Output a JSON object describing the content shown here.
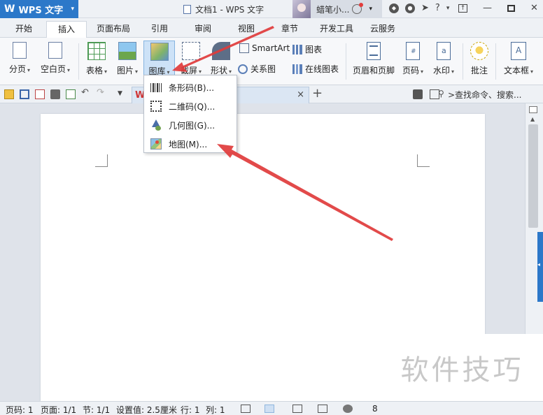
{
  "titlebar": {
    "app_logo": "W",
    "app_name": "WPS 文字",
    "app_caret": "▾",
    "doc_title": "文档1 - WPS 文字",
    "user_name": "蜡笔小...",
    "help": "?"
  },
  "ribbon_tabs": [
    "开始",
    "插入",
    "页面布局",
    "引用",
    "审阅",
    "视图",
    "章节",
    "开发工具",
    "云服务"
  ],
  "ribbon": {
    "page_break": "分页",
    "blank_page": "空白页",
    "table": "表格",
    "picture": "图片",
    "gallery": "图库",
    "screenshot": "截屏",
    "shapes": "形状",
    "smartart": "SmartArt",
    "chart": "图表",
    "relation": "关系图",
    "online_chart": "在线图表",
    "header_footer": "页眉和页脚",
    "page_number": "页码",
    "watermark": "水印",
    "comment": "批注",
    "textbox": "文本框"
  },
  "quickbar": {
    "doc_tab_logo": "W",
    "doc_tab_close": "×",
    "new_tab": "+",
    "search_cmd": ">查找命令、搜索..."
  },
  "gallery_menu": {
    "items": [
      "条形码(B)...",
      "二维码(Q)...",
      "几何图(G)...",
      "地图(M)..."
    ]
  },
  "statusbar": {
    "page_num": "页码: 1",
    "pages": "页面: 1/1",
    "section": "节: 1/1",
    "setting": "设置值: 2.5厘米",
    "row": "行: 1",
    "col": "列: 1",
    "zoom": "8"
  },
  "watermark_text": "软件技巧",
  "colors": {
    "app_blue": "#2c78c9",
    "arrow_red": "#e03b3b",
    "highlight": "#cde2f7"
  }
}
